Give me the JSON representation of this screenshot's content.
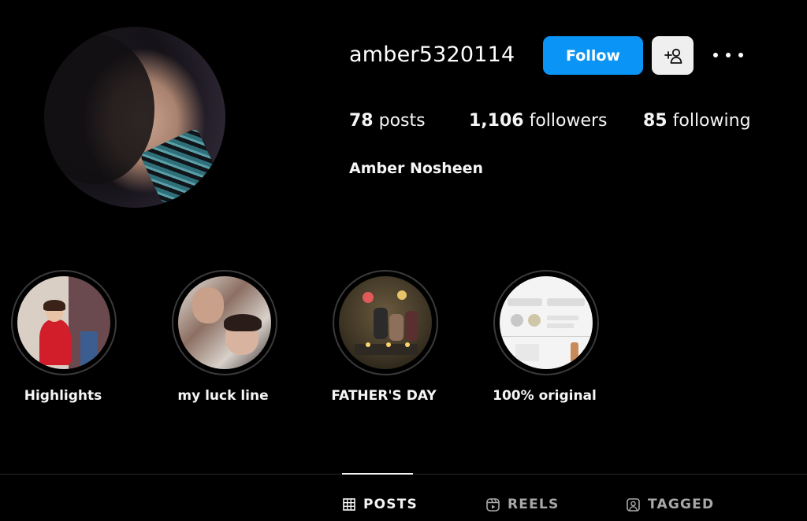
{
  "profile": {
    "username": "amber5320114",
    "full_name": "Amber Nosheen",
    "avatar_icon": "profile-photo"
  },
  "actions": {
    "follow_label": "Follow",
    "add_user_icon": "person-plus-icon",
    "more_icon": "more-horizontal-icon"
  },
  "stats": {
    "posts": {
      "count": "78",
      "label": "posts"
    },
    "followers": {
      "count": "1,106",
      "label": "followers"
    },
    "following": {
      "count": "85",
      "label": "following"
    }
  },
  "highlights": [
    {
      "label": "Highlights"
    },
    {
      "label": "my luck line"
    },
    {
      "label": "FATHER'S DAY"
    },
    {
      "label": "100% original"
    }
  ],
  "tabs": [
    {
      "label": "POSTS",
      "icon": "grid-icon",
      "active": true
    },
    {
      "label": "REELS",
      "icon": "reels-icon",
      "active": false
    },
    {
      "label": "TAGGED",
      "icon": "tagged-icon",
      "active": false
    }
  ],
  "colors": {
    "background": "#000000",
    "follow_button": "#0a95f6",
    "secondary_button": "#efefef",
    "text": "#f5f5f5",
    "muted_text": "#a8a8a8"
  }
}
